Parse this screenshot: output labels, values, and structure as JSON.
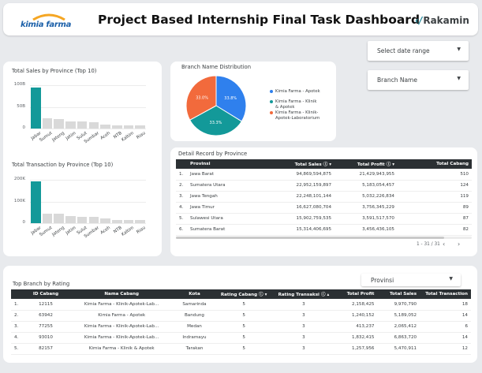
{
  "header": {
    "title": "Project Based Internship Final Task Dashboard",
    "left_logo": "kimia farma",
    "right_logo": "Rakamin",
    "right_logo_mark": "‹/"
  },
  "filters": {
    "date_range": "Select date range",
    "branch_name": "Branch Name",
    "provinsi": "Provinsi"
  },
  "sales_chart": {
    "title": "Total Sales by Province (Top 10)"
  },
  "transaction_chart": {
    "title": "Total Transaction by Province (Top 10)"
  },
  "pie": {
    "title": "Branch Name Distribution",
    "slice_labels": [
      "33.8%",
      "33.3%",
      "33.0%"
    ]
  },
  "detail": {
    "title": "Detail Record by Province",
    "columns": [
      "Provinsi",
      "Total Sales",
      "Total Profit",
      "Total Cabang"
    ],
    "rows": [
      [
        "1.",
        "Jawa Barat",
        "94,869,594,875",
        "21,429,943,955",
        "510"
      ],
      [
        "2.",
        "Sumatera Utara",
        "22,952,159,897",
        "5,183,054,457",
        "124"
      ],
      [
        "3.",
        "Jawa Tengah",
        "22,248,101,144",
        "5,032,226,834",
        "119"
      ],
      [
        "4.",
        "Jawa Timur",
        "16,627,080,704",
        "3,756,345,229",
        "89"
      ],
      [
        "5.",
        "Sulawesi Utara",
        "15,902,759,535",
        "3,591,517,570",
        "87"
      ],
      [
        "6.",
        "Sumatera Barat",
        "15,314,406,695",
        "3,456,436,105",
        "82"
      ]
    ],
    "pager": "1 - 31 / 31"
  },
  "top_branch": {
    "title": "Top Branch by Rating",
    "columns": [
      "ID Cabang",
      "Nama Cabang",
      "Kota",
      "Rating Cabang",
      "Rating Transaksi",
      "Total Profit",
      "Total Sales",
      "Total Transaction"
    ],
    "rows": [
      [
        "1.",
        "12115",
        "Kimia Farma - Klinik-Apotek-Lab…",
        "Samarinda",
        "5",
        "3",
        "2,158,425",
        "9,970,790",
        "18"
      ],
      [
        "2.",
        "63942",
        "Kimia Farma - Apotek",
        "Bandung",
        "5",
        "3",
        "1,240,152",
        "5,189,052",
        "14"
      ],
      [
        "3.",
        "77255",
        "Kimia Farma - Klinik-Apotek-Lab…",
        "Medan",
        "5",
        "3",
        "413,237",
        "2,065,412",
        "6"
      ],
      [
        "4.",
        "93010",
        "Kimia Farma - Klinik-Apotek-Lab…",
        "Indramayu",
        "5",
        "3",
        "1,832,415",
        "6,863,720",
        "14"
      ],
      [
        "5.",
        "82157",
        "Kimia Farma - Klinik & Apotek",
        "Tarakan",
        "5",
        "3",
        "1,257,956",
        "5,470,911",
        "12"
      ]
    ]
  },
  "colors": {
    "teal": "#139999",
    "gray_bar": "#d9d9d9",
    "blue": "#2f80ed",
    "orange": "#f26a3c",
    "header_dark": "#2b3033"
  },
  "chart_data": [
    {
      "type": "bar",
      "title": "Total Sales by Province (Top 10)",
      "categories": [
        "Jabar",
        "Sumut",
        "Jateng",
        "Jatim",
        "Sulut",
        "Sumbar",
        "Aceh",
        "NTB",
        "Kaltim",
        "Riau"
      ],
      "values": [
        95,
        23,
        22,
        17,
        16,
        15,
        10,
        8,
        8,
        7
      ],
      "yticks": [
        "0",
        "50B",
        "100B"
      ],
      "ylim": [
        0,
        100
      ]
    },
    {
      "type": "bar",
      "title": "Total Transaction by Province (Top 10)",
      "categories": [
        "Jabar",
        "Sumut",
        "Jateng",
        "Jatim",
        "Sulut",
        "Sumbar",
        "Aceh",
        "NTB",
        "Kaltim",
        "Riau"
      ],
      "values": [
        192,
        45,
        44,
        33,
        30,
        30,
        21,
        16,
        16,
        15
      ],
      "yticks": [
        "0",
        "100K",
        "200K"
      ],
      "ylim": [
        0,
        200
      ]
    },
    {
      "type": "pie",
      "title": "Branch Name Distribution",
      "labels": [
        "Kimia Farma - Apotek",
        "Kimia Farma - Klinik & Apotek",
        "Kimia Farma - Klinik-Apotek-Laboratorium"
      ],
      "values": [
        33.8,
        33.3,
        33.0
      ],
      "colors": [
        "#2f80ed",
        "#139999",
        "#f26a3c"
      ]
    }
  ]
}
